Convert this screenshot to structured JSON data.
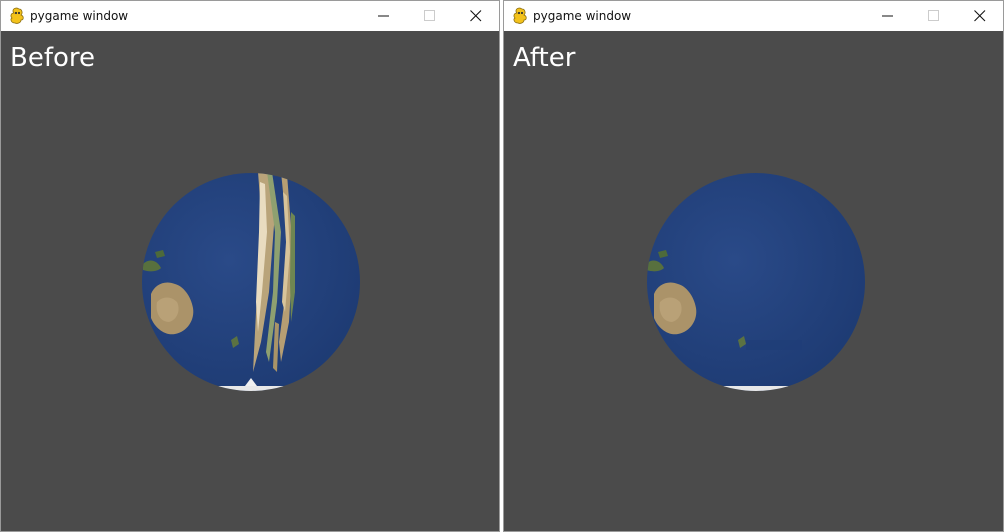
{
  "windows": [
    {
      "title": "pygame window",
      "overlay_label": "Before",
      "icon": "pygame-snake-icon",
      "controls": [
        "minimize-icon",
        "maximize-icon",
        "close-icon"
      ]
    },
    {
      "title": "pygame window",
      "overlay_label": "After",
      "icon": "pygame-snake-icon",
      "controls": [
        "minimize-icon",
        "maximize-icon",
        "close-icon"
      ]
    }
  ],
  "colors": {
    "canvas_background": "#4b4b4b",
    "ocean": "#23427c",
    "land": "#a8926a",
    "titlebar": "#ffffff"
  }
}
